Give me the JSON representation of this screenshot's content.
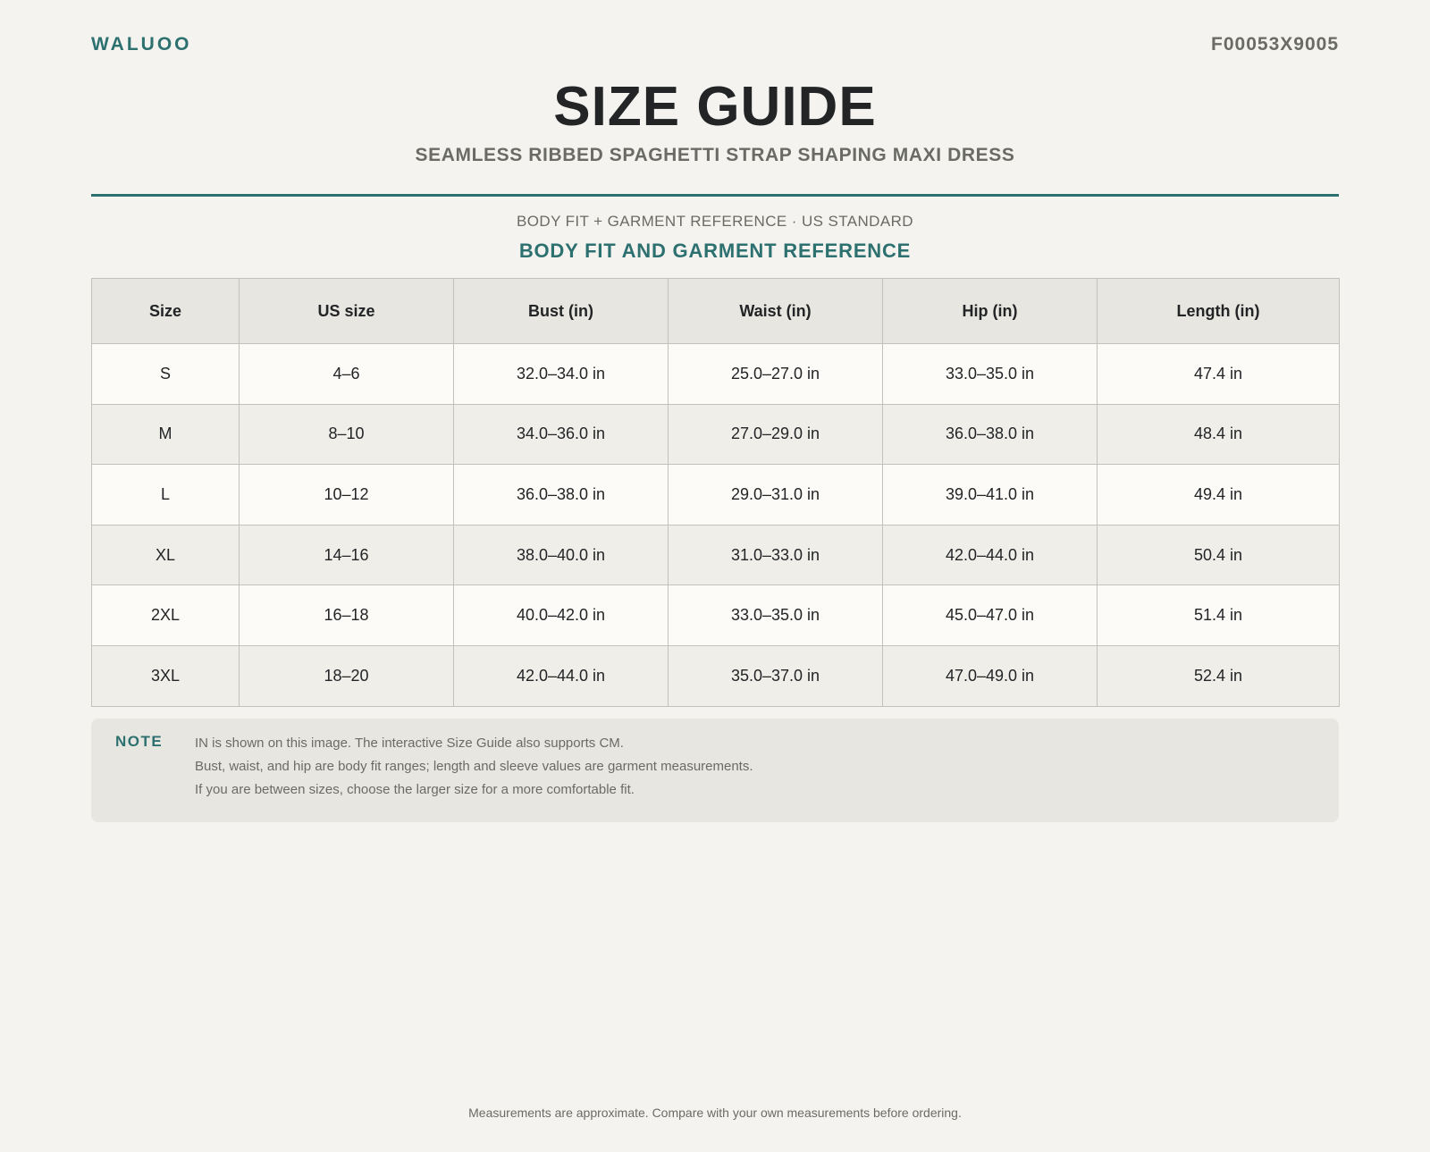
{
  "header": {
    "brand": "WALUOO",
    "sku": "F00053X9005",
    "title": "SIZE GUIDE",
    "subtitle": "SEAMLESS RIBBED SPAGHETTI STRAP SHAPING MAXI DRESS"
  },
  "section": {
    "meta": "BODY FIT + GARMENT REFERENCE · US STANDARD",
    "title": "BODY FIT AND GARMENT REFERENCE"
  },
  "table": {
    "columns": [
      "Size",
      "US size",
      "Bust (in)",
      "Waist (in)",
      "Hip (in)",
      "Length (in)"
    ],
    "rows": [
      [
        "S",
        "4–6",
        "32.0–34.0 in",
        "25.0–27.0 in",
        "33.0–35.0 in",
        "47.4 in"
      ],
      [
        "M",
        "8–10",
        "34.0–36.0 in",
        "27.0–29.0 in",
        "36.0–38.0 in",
        "48.4 in"
      ],
      [
        "L",
        "10–12",
        "36.0–38.0 in",
        "29.0–31.0 in",
        "39.0–41.0 in",
        "49.4 in"
      ],
      [
        "XL",
        "14–16",
        "38.0–40.0 in",
        "31.0–33.0 in",
        "42.0–44.0 in",
        "50.4 in"
      ],
      [
        "2XL",
        "16–18",
        "40.0–42.0 in",
        "33.0–35.0 in",
        "45.0–47.0 in",
        "51.4 in"
      ],
      [
        "3XL",
        "18–20",
        "42.0–44.0 in",
        "35.0–37.0 in",
        "47.0–49.0 in",
        "52.4 in"
      ]
    ]
  },
  "note": {
    "label": "NOTE",
    "lines": [
      "IN is shown on this image. The interactive Size Guide also supports CM.",
      "Bust, waist, and hip are body fit ranges; length and sleeve values are garment measurements.",
      "If you are between sizes, choose the larger size for a more comfortable fit."
    ]
  },
  "footer": {
    "text": "Measurements are approximate. Compare with your own measurements before ordering."
  },
  "colors": {
    "accent": "#2d7070",
    "background": "#f4f3ef",
    "muted_text": "#6b6b66",
    "header_fill": "#e8e6e0"
  }
}
